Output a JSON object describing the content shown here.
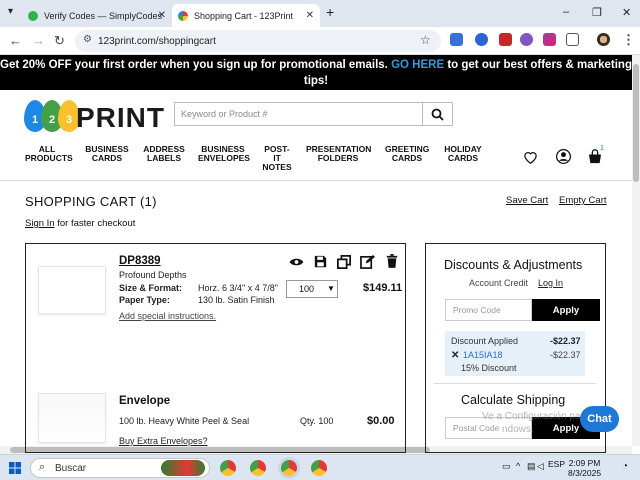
{
  "browser": {
    "tabs": [
      {
        "label": "Verify Codes — SimplyCodes",
        "active": false
      },
      {
        "label": "Shopping Cart - 123Print",
        "active": true
      }
    ],
    "new_tab": "+",
    "url": "123print.com/shoppingcart",
    "win_controls": [
      "–",
      "❐",
      "✕"
    ]
  },
  "promo": {
    "text_before": "Get 20% OFF your first order",
    "text_middle": " when you sign up for promotional emails. ",
    "go_here": "GO HERE",
    "text_after": " to get our best offers & marketing tips!"
  },
  "header": {
    "logo_digits": [
      "1",
      "2",
      "3"
    ],
    "logo_text": "PRINT",
    "search_placeholder": "Keyword or Product #",
    "cart_count": "1"
  },
  "nav": [
    {
      "label": "ALL PRODUCTS"
    },
    {
      "label": "BUSINESS CARDS"
    },
    {
      "label": "ADDRESS LABELS"
    },
    {
      "label": "BUSINESS ENVELOPES"
    },
    {
      "label": "POST-IT NOTES"
    },
    {
      "label": "PRESENTATION FOLDERS"
    },
    {
      "label": "GREETING CARDS"
    },
    {
      "label": "HOLIDAY CARDS"
    }
  ],
  "cart": {
    "title": "SHOPPING CART (1)",
    "save_cart": "Save Cart",
    "empty_cart": "Empty Cart",
    "sign_in": "Sign In",
    "checkout_text": " for faster checkout",
    "items": [
      {
        "sku": "DP8389",
        "name": "Profound Depths",
        "size_label": "Size & Format:",
        "size_value": "Horz. 6 3/4\" x 4 7/8\"",
        "paper_label": "Paper Type:",
        "paper_value": "130 lb. Satin Finish",
        "qty": "100",
        "price": "$149.11",
        "instructions": "Add special instructions."
      },
      {
        "title": "Envelope",
        "desc": "100 lb. Heavy White Peel & Seal",
        "qty": "Qty. 100",
        "price": "$0.00",
        "extra": "Buy Extra Envelopes?"
      }
    ]
  },
  "side": {
    "discounts_title": "Discounts & Adjustments",
    "account_credit": "Account Credit",
    "login": "Log In",
    "promo_placeholder": "Promo Code",
    "apply": "Apply",
    "discount_applied": "Discount Applied",
    "discount_total": "-$22.37",
    "code": "1A15IA18",
    "code_amount": "-$22.37",
    "code_desc": "15% Discount",
    "shipping_title": "Calculate Shipping",
    "postal_placeholder": "Postal Code",
    "apply2": "Apply"
  },
  "chat": "Chat",
  "watermark": {
    "line1": "Ve a Configuración para",
    "line2": "ndows."
  },
  "taskbar": {
    "search": "Buscar",
    "lang": "ESP",
    "time": "2:09 PM",
    "date": "8/3/2025"
  }
}
